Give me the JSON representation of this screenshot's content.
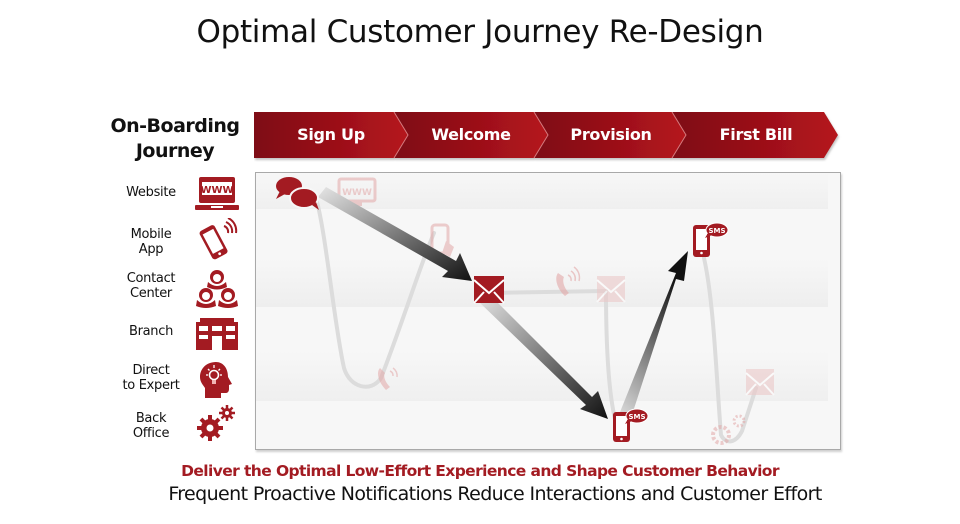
{
  "title": "Optimal Customer Journey Re-Design",
  "journey": {
    "label_line1": "On-Boarding",
    "label_line2": "Journey"
  },
  "stages": [
    {
      "label": "Sign Up"
    },
    {
      "label": "Welcome"
    },
    {
      "label": "Provision"
    },
    {
      "label": "First Bill"
    }
  ],
  "channels": [
    {
      "line1": "Website",
      "line2": "",
      "icon": "www-laptop-icon"
    },
    {
      "line1": "Mobile",
      "line2": "App",
      "icon": "mobile-phone-icon"
    },
    {
      "line1": "Contact",
      "line2": "Center",
      "icon": "contact-center-agents-icon"
    },
    {
      "line1": "Branch",
      "line2": "",
      "icon": "branch-building-icon"
    },
    {
      "line1": "Direct",
      "line2": "to Expert",
      "icon": "expert-head-lightbulb-icon"
    },
    {
      "line1": "Back",
      "line2": "Office",
      "icon": "gears-icon"
    }
  ],
  "journey_map": {
    "optimal_path": [
      {
        "stage": "Sign Up",
        "channel": "Contact Center",
        "icon": "chat-bubbles-icon"
      },
      {
        "stage": "Welcome",
        "channel": "Contact Center",
        "icon": "email-icon"
      },
      {
        "stage": "Provision",
        "channel": "Back Office",
        "icon": "sms-phone-icon",
        "badge": "SMS"
      },
      {
        "stage": "First Bill",
        "channel": "Mobile App",
        "icon": "sms-phone-icon",
        "badge": "SMS"
      }
    ],
    "legacy_path_icons": [
      "www-icon",
      "mobile-touch-icon",
      "phone-call-icon",
      "phone-call-icon",
      "email-icon",
      "gears-icon",
      "email-icon"
    ]
  },
  "taglines": {
    "primary": "Deliver the Optimal Low-Effort Experience and Shape Customer Behavior",
    "secondary": "Frequent Proactive Notifications Reduce Interactions and Customer Effort"
  },
  "colors": {
    "brand_red": "#a31b22",
    "dark_red": "#8a0f17",
    "faded_red": "#ecc9c9",
    "legacy_line": "#d9d9d9",
    "arrow_dark": "#1a1a1a"
  }
}
